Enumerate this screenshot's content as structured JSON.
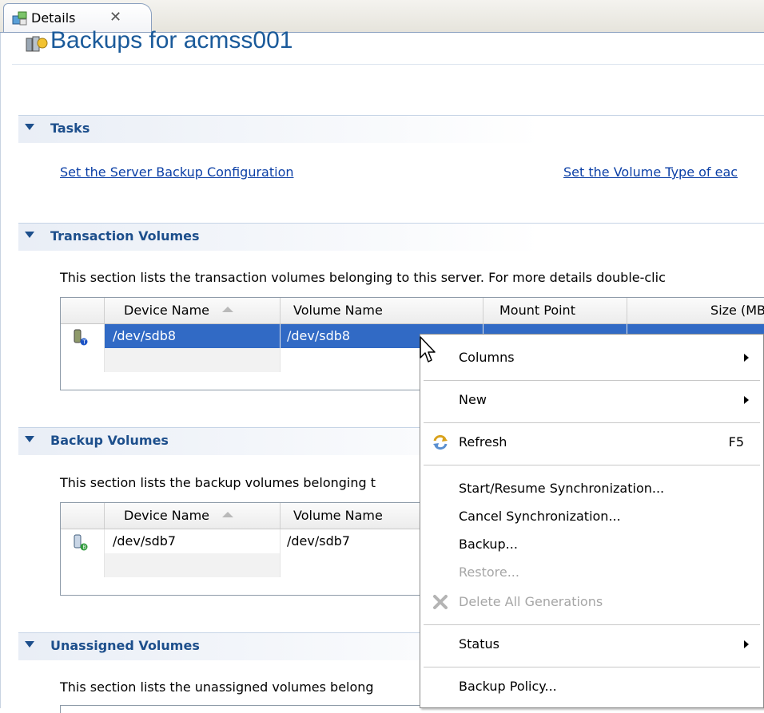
{
  "tab": {
    "label": "Details",
    "close": "✕"
  },
  "page": {
    "title": "Backups for acmss001"
  },
  "tasks": {
    "title": "Tasks",
    "links": [
      "Set the Server Backup Configuration",
      "Set the Volume Type of eac"
    ]
  },
  "transaction": {
    "title": "Transaction Volumes",
    "description": "This section lists the transaction volumes belonging to this server. For more details double-clic",
    "columns": [
      "Device Name",
      "Volume Name",
      "Mount Point",
      "Size (MB"
    ],
    "rows": [
      {
        "device": "/dev/sdb8",
        "volume": "/dev/sdb8",
        "mount": "",
        "size": ""
      }
    ]
  },
  "backup": {
    "title": "Backup Volumes",
    "description": "This section lists the backup volumes belonging t",
    "columns": [
      "Device Name",
      "Volume Name"
    ],
    "rows": [
      {
        "device": "/dev/sdb7",
        "volume": "/dev/sdb7"
      }
    ]
  },
  "unassigned": {
    "title": "Unassigned Volumes",
    "description": "This section lists the unassigned volumes belong"
  },
  "context_menu": {
    "items": [
      {
        "label": "Columns",
        "submenu": true
      },
      {
        "label": "New",
        "submenu": true
      },
      {
        "label": "Refresh",
        "shortcut": "F5",
        "icon": "refresh-icon"
      },
      {
        "label": "Start/Resume Synchronization..."
      },
      {
        "label": "Cancel Synchronization..."
      },
      {
        "label": "Backup..."
      },
      {
        "label": "Restore...",
        "disabled": true
      },
      {
        "label": "Delete All Generations",
        "disabled": true,
        "icon": "delete-icon"
      },
      {
        "label": "Status",
        "submenu": true
      },
      {
        "label": "Backup Policy..."
      }
    ]
  },
  "colors": {
    "accent": "#1d4f8c",
    "selection": "#316ac5",
    "link": "#0b3fa6"
  }
}
